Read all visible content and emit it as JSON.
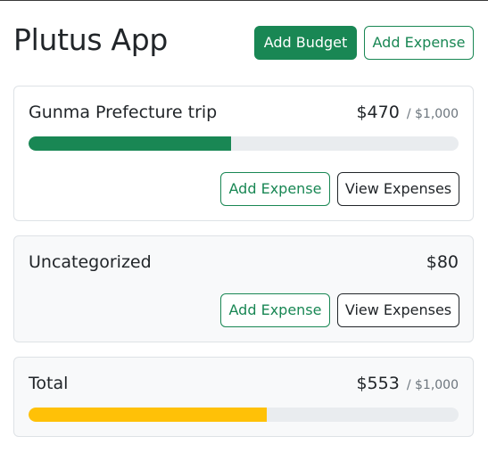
{
  "app": {
    "title": "Plutus App",
    "add_budget_label": "Add Budget",
    "add_expense_label": "Add Expense"
  },
  "budgets": [
    {
      "name": "Gunma Prefecture trip",
      "spent": "$470",
      "max": "/ $1,000",
      "progress_fraction": 0.47,
      "bar_color": "#198754",
      "add_expense_label": "Add Expense",
      "view_expenses_label": "View Expenses"
    },
    {
      "name": "Uncategorized",
      "spent": "$80",
      "add_expense_label": "Add Expense",
      "view_expenses_label": "View Expenses"
    },
    {
      "name": "Total",
      "spent": "$553",
      "max": "/ $1,000",
      "progress_fraction": 0.553,
      "bar_color": "#ffc107"
    }
  ]
}
